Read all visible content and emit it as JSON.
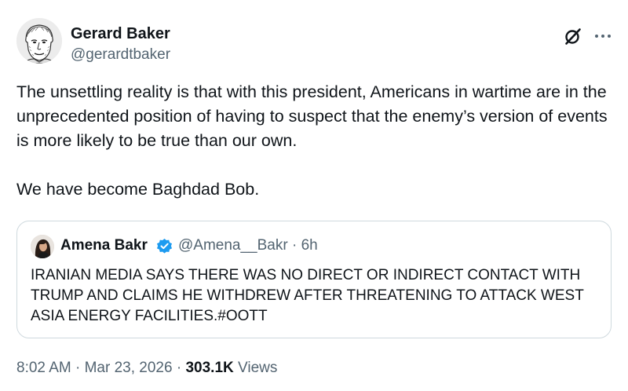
{
  "author": {
    "name": "Gerard Baker",
    "handle": "@gerardtbaker",
    "avatar_icon": "sketch-portrait-avatar"
  },
  "header_icons": {
    "grok": "grok-slash-circle-icon",
    "more": "more-horizontal-icon",
    "more_glyph": "···"
  },
  "tweet": {
    "paragraphs": [
      "The unsettling reality is that with this president, Americans in wartime are in the unprecedented position of having to suspect that the enemy’s version of events is more likely to be true than our own.",
      "We have become Baghdad Bob."
    ]
  },
  "quote": {
    "author_name": "Amena Bakr",
    "verified": true,
    "verified_color": "#1d9bf0",
    "handle": "@Amena__Bakr",
    "separator": "·",
    "age": "6h",
    "text": "IRANIAN MEDIA SAYS THERE WAS NO DIRECT OR INDIRECT CONTACT WITH TRUMP AND CLAIMS HE WITHDREW AFTER THREATENING TO ATTACK WEST ASIA ENERGY FACILITIES.#OOTT"
  },
  "footer": {
    "time": "8:02 AM",
    "separator": "·",
    "date": "Mar 23, 2026",
    "views_count": "303.1K",
    "views_label": "Views"
  },
  "colors": {
    "text": "#0f1419",
    "secondary": "#536471",
    "border": "#cfd9de",
    "background": "#ffffff"
  }
}
